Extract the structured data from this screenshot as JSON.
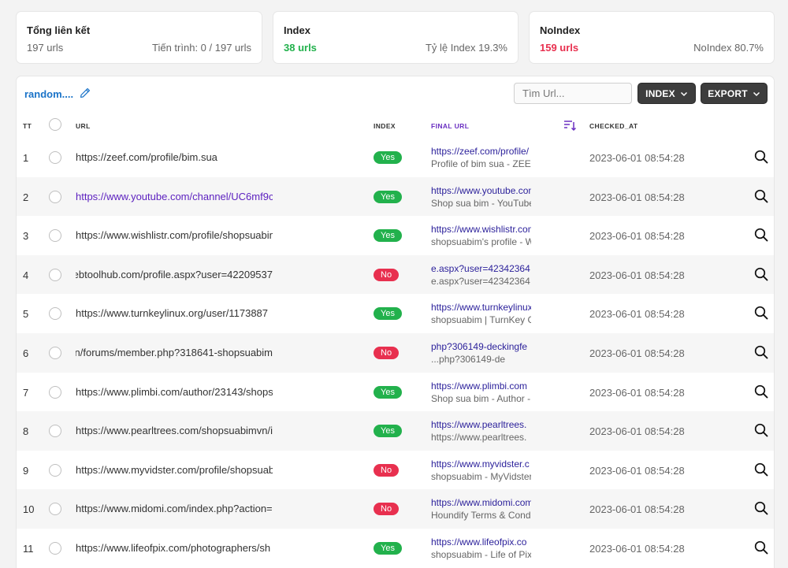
{
  "cards": {
    "total": {
      "title": "Tổng liên kết",
      "left": "197 urls",
      "right": "Tiến trình: 0 / 197 urls"
    },
    "index": {
      "title": "Index",
      "left": "38 urls",
      "right": "Tỷ lệ Index 19.3%"
    },
    "noindex": {
      "title": "NoIndex",
      "left": "159 urls",
      "right": "NoIndex 80.7%"
    }
  },
  "toolbar": {
    "project_name": "random....",
    "search_placeholder": "Tìm Url...",
    "index_button": "INDEX",
    "export_button": "EXPORT"
  },
  "columns": {
    "tt": "TT",
    "url": "URL",
    "index": "INDEX",
    "final_url": "FINAL URL",
    "checked_at": "CHECKED_AT"
  },
  "rows": [
    {
      "tt": "1",
      "url": "https://zeef.com/profile/bim.sua",
      "index": "Yes",
      "final_link": "https://zeef.com/profile/",
      "final_title": "Profile of bim sua - ZEEF",
      "checked": "2023-06-01 08:54:28"
    },
    {
      "tt": "2",
      "url": "https://www.youtube.com/channel/UC6mf9c",
      "index": "Yes",
      "final_link": "https://www.youtube.com",
      "final_title": "Shop sua bim - YouTube",
      "checked": "2023-06-01 08:54:28"
    },
    {
      "tt": "3",
      "url": "https://www.wishlistr.com/profile/shopsuabim",
      "index": "Yes",
      "final_link": "https://www.wishlistr.com",
      "final_title": "shopsuabim's profile - W",
      "checked": "2023-06-01 08:54:28"
    },
    {
      "tt": "4",
      "url": "ebtoolhub.com/profile.aspx?user=42209537",
      "index": "No",
      "final_link": "e.aspx?user=42342364",
      "final_title": "e.aspx?user=42342364",
      "checked": "2023-06-01 08:54:28"
    },
    {
      "tt": "5",
      "url": "https://www.turnkeylinux.org/user/1173887",
      "index": "Yes",
      "final_link": "https://www.turnkeylinux",
      "final_title": "shopsuabim | TurnKey G",
      "checked": "2023-06-01 08:54:28"
    },
    {
      "tt": "6",
      "url": "n/forums/member.php?318641-shopsuabim",
      "index": "No",
      "final_link": "php?306149-deckingfe",
      "final_title": "php?306149-de...",
      "checked": "2023-06-01 08:54:28"
    },
    {
      "tt": "7",
      "url": "https://www.plimbi.com/author/23143/shops",
      "index": "Yes",
      "final_link": "https://www.plimbi.com",
      "final_title": "Shop sua bim - Author -",
      "checked": "2023-06-01 08:54:28"
    },
    {
      "tt": "8",
      "url": "https://www.pearltrees.com/shopsuabimvn/i",
      "index": "Yes",
      "final_link": "https://www.pearltrees.",
      "final_title": "https://www.pearltrees.",
      "checked": "2023-06-01 08:54:28"
    },
    {
      "tt": "9",
      "url": "https://www.myvidster.com/profile/shopsuab",
      "index": "No",
      "final_link": "https://www.myvidster.c",
      "final_title": "shopsuabim - MyVidster",
      "checked": "2023-06-01 08:54:28"
    },
    {
      "tt": "10",
      "url": "https://www.midomi.com/index.php?action=",
      "index": "No",
      "final_link": "https://www.midomi.com",
      "final_title": "Houndify Terms & Cond",
      "checked": "2023-06-01 08:54:28"
    },
    {
      "tt": "11",
      "url": "https://www.lifeofpix.com/photographers/sh",
      "index": "Yes",
      "final_link": "https://www.lifeofpix.co",
      "final_title": "shopsuabim - Life of Pix",
      "checked": "2023-06-01 08:54:28"
    }
  ]
}
